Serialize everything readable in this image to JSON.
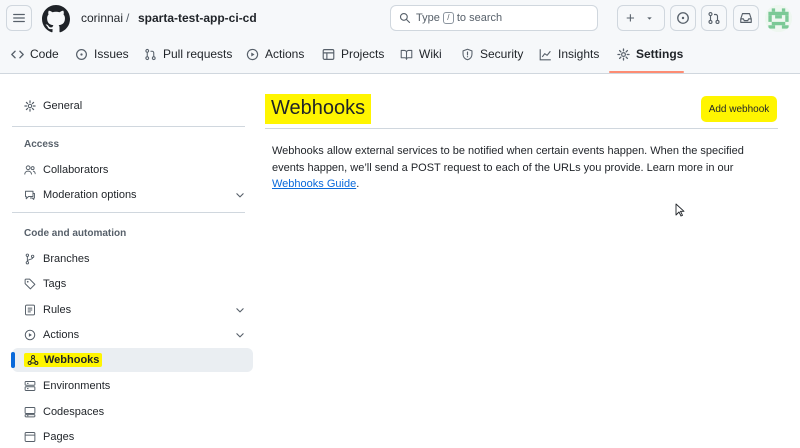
{
  "header": {
    "owner": "corinnai",
    "separator": "/",
    "repo": "sparta-test-app-ci-cd",
    "search": {
      "prefix": "Type",
      "key": "/",
      "suffix": "to search"
    },
    "new_button_label": "+"
  },
  "repo_nav": {
    "tabs": [
      {
        "label": "Code",
        "icon": "code-icon"
      },
      {
        "label": "Issues",
        "icon": "issue-icon"
      },
      {
        "label": "Pull requests",
        "icon": "pull-request-icon"
      },
      {
        "label": "Actions",
        "icon": "play-icon"
      },
      {
        "label": "Projects",
        "icon": "table-icon"
      },
      {
        "label": "Wiki",
        "icon": "book-icon"
      },
      {
        "label": "Security",
        "icon": "shield-icon"
      },
      {
        "label": "Insights",
        "icon": "graph-icon"
      },
      {
        "label": "Settings",
        "icon": "gear-icon",
        "active": true
      }
    ]
  },
  "sidebar": {
    "general": "General",
    "access_heading": "Access",
    "access_items": [
      {
        "label": "Collaborators",
        "icon": "people-icon"
      },
      {
        "label": "Moderation options",
        "icon": "comment-icon",
        "expandable": true
      }
    ],
    "automation_heading": "Code and automation",
    "automation_items": [
      {
        "label": "Branches",
        "icon": "branch-icon"
      },
      {
        "label": "Tags",
        "icon": "tag-icon"
      },
      {
        "label": "Rules",
        "icon": "rules-icon",
        "expandable": true
      },
      {
        "label": "Actions",
        "icon": "play-icon",
        "expandable": true
      },
      {
        "label": "Webhooks",
        "icon": "webhook-icon",
        "selected": true,
        "highlighted": true
      },
      {
        "label": "Environments",
        "icon": "server-icon"
      },
      {
        "label": "Codespaces",
        "icon": "codespaces-icon"
      },
      {
        "label": "Pages",
        "icon": "browser-icon"
      }
    ]
  },
  "main": {
    "title": "Webhooks",
    "add_button": "Add webhook",
    "description": "Webhooks allow external services to be notified when certain events happen. When the specified events happen, we’ll send a POST request to each of the URLs you provide. Learn more in our",
    "guide_link": "Webhooks Guide",
    "trailing": "."
  },
  "colors": {
    "highlight": "#fff500",
    "link": "#0969da",
    "active_underline": "#fd8c73",
    "selected_bar": "#0969da"
  }
}
